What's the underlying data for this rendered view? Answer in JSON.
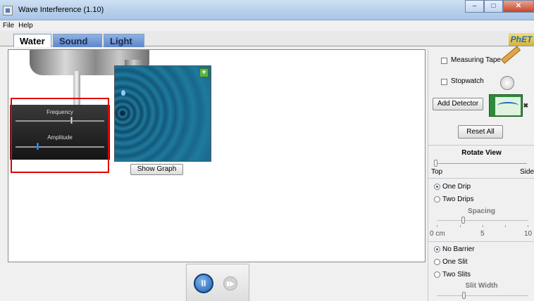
{
  "window": {
    "title": "Wave Interference (1.10)",
    "minimize_glyph": "–",
    "maximize_glyph": "□",
    "close_glyph": "✕"
  },
  "menu": [
    "File",
    "Help"
  ],
  "tabs": [
    {
      "label": "Water",
      "active": true
    },
    {
      "label": "Sound",
      "active": false
    },
    {
      "label": "Light",
      "active": false
    }
  ],
  "logo": "PhET",
  "controls": {
    "frequency_label": "Frequency",
    "amplitude_label": "Amplitude",
    "show_graph": "Show Graph",
    "add_source_glyph": "+"
  },
  "playback": {
    "pause_glyph": "II",
    "step_glyph": "▮▶"
  },
  "tools": {
    "measuring_tape": "Measuring Tape",
    "stopwatch": "Stopwatch",
    "add_detector": "Add Detector",
    "reset_all": "Reset All"
  },
  "rotate_view": {
    "title": "Rotate View",
    "left_label": "Top",
    "right_label": "Side"
  },
  "sources": {
    "one_drip": "One Drip",
    "two_drips": "Two Drips",
    "selected": "One Drip",
    "spacing_label": "Spacing",
    "spacing_ticks": [
      "0 cm",
      "5",
      "10"
    ]
  },
  "barriers": {
    "no_barrier": "No Barrier",
    "one_slit": "One Slit",
    "two_slits": "Two Slits",
    "selected": "No Barrier",
    "slit_width_label": "Slit Width"
  },
  "colors": {
    "highlight": "#e00000",
    "water": "#1f7a9e",
    "amplitude_knob": "#4aa8ff"
  }
}
